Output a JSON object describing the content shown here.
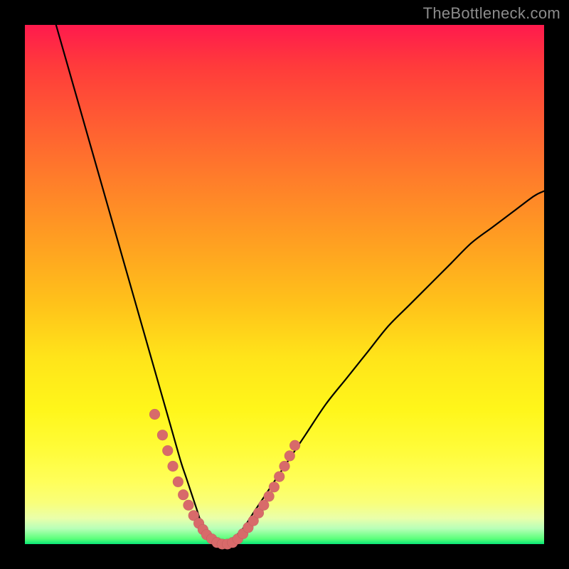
{
  "watermark": "TheBottleneck.com",
  "colors": {
    "background": "#000000",
    "curve": "#000000",
    "dots": "#d86a6a",
    "gradient_top": "#ff1a4d",
    "gradient_bottom": "#07e676"
  },
  "chart_data": {
    "type": "line",
    "title": "",
    "xlabel": "",
    "ylabel": "",
    "xlim": [
      0,
      100
    ],
    "ylim": [
      0,
      100
    ],
    "grid": false,
    "legend": false,
    "series": [
      {
        "name": "bottleneck-curve",
        "x": [
          6,
          8,
          10,
          12,
          14,
          16,
          18,
          20,
          22,
          24,
          26,
          28,
          30,
          31,
          32,
          33,
          34,
          35,
          36,
          37,
          38,
          39,
          40,
          42,
          44,
          46,
          48,
          50,
          54,
          58,
          62,
          66,
          70,
          74,
          78,
          82,
          86,
          90,
          94,
          98,
          100
        ],
        "y": [
          100,
          93,
          86,
          79,
          72,
          65,
          58,
          51,
          44,
          37,
          30,
          23,
          16,
          13,
          10,
          7,
          4,
          2,
          1,
          0,
          0,
          0,
          1,
          3,
          6,
          9,
          12,
          15,
          21,
          27,
          32,
          37,
          42,
          46,
          50,
          54,
          58,
          61,
          64,
          67,
          68
        ]
      }
    ],
    "highlight_points": {
      "name": "highlighted-dots",
      "x": [
        25,
        26.5,
        27.5,
        28.5,
        29.5,
        30.5,
        31.5,
        32.5,
        33.5,
        34.3,
        35,
        36,
        37,
        38,
        39,
        40,
        41,
        42,
        43,
        44,
        45,
        46,
        47,
        48,
        49,
        50,
        51,
        52
      ],
      "y": [
        25,
        21,
        18,
        15,
        12,
        9.5,
        7.5,
        5.5,
        4,
        2.8,
        1.8,
        1,
        0.3,
        0,
        0,
        0.3,
        1,
        2,
        3.2,
        4.5,
        6,
        7.5,
        9.2,
        11,
        13,
        15,
        17,
        19
      ]
    }
  }
}
